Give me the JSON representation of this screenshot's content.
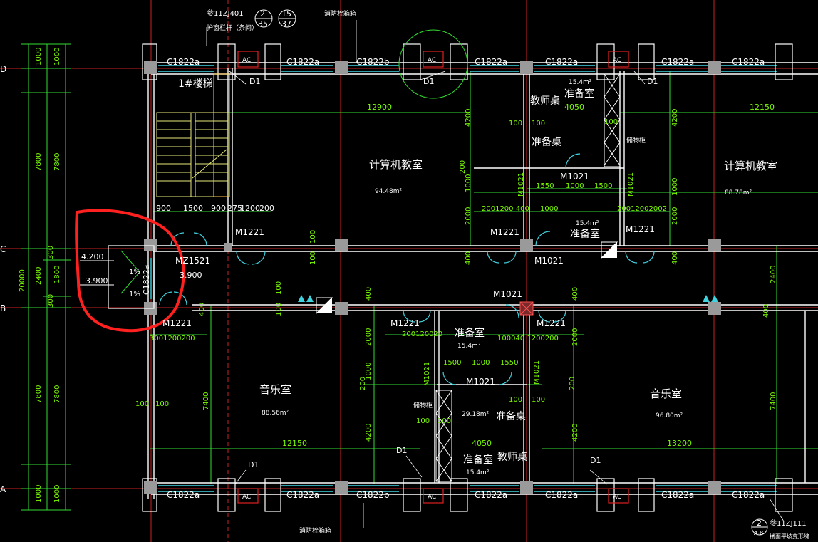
{
  "drawing": {
    "colors": {
      "background": "#000000",
      "axis": "#cc2222",
      "dim": "#33dd33",
      "wall": "#ffffff",
      "window": "#3fd3e0",
      "text": "#ffffff",
      "ac_box": "#e02020",
      "highlight": "#ff2020",
      "column": "#9a9a9a",
      "stair": "#e8e87a",
      "grid_line": "#00ff66"
    },
    "header": {
      "ref_code": "参11ZJ401",
      "circle_a": "2",
      "circle_a_sub": "35",
      "circle_b": "15",
      "circle_b_sub": "37",
      "rail_note": "护窗栏杆（条间）",
      "fire_box_top": "消防栓箱箱"
    },
    "axis_labels": {
      "d": "D",
      "c": "C",
      "b": "B",
      "a": "A"
    },
    "left_dims": {
      "top_1000a": "1000",
      "top_1000b": "1000",
      "dim_7800_top": "7800",
      "dim_7800_top_b": "7800",
      "dim_20000": "20000",
      "d300_top": "300",
      "d2400": "2400",
      "d1800": "1800",
      "d300_bot": "300",
      "dim_7800_bot": "7800",
      "dim_7800_bot_b": "7800",
      "bot_1000a": "1000",
      "bot_1000b": "1000"
    },
    "windows_top": [
      "C1822a",
      "C1822a",
      "C1822b",
      "C1822a",
      "C1822a",
      "C1822a",
      "C1822a"
    ],
    "windows_bottom": [
      "C1822a",
      "C1822a",
      "C1822b",
      "C1822a",
      "C1822a",
      "C1822a",
      "C1822a"
    ],
    "ac_label": "AC",
    "d1": "D1",
    "stair": {
      "label": "1#楼梯",
      "dims": [
        "900",
        "1500",
        "900",
        "275",
        "1200",
        "200"
      ]
    },
    "rooms": {
      "comp1": {
        "name": "计算机教室",
        "area": "94.48m²"
      },
      "comp2": {
        "name": "计算机教室",
        "area": "88.78m²"
      },
      "prep_top": {
        "name": "准备室",
        "area": "15.4m²"
      },
      "prep_mid": {
        "name": "准备室",
        "area": "15.4m²"
      },
      "music1": {
        "name": "音乐室",
        "area": "88.56m²"
      },
      "music2": {
        "name": "音乐室",
        "area": "96.80m²"
      },
      "prep_b1": {
        "name": "准备室",
        "area": "15.4m²"
      },
      "prep_b2": {
        "name": "准备室",
        "area": "29.18m²"
      },
      "prep_b3": {
        "name": "准备室",
        "area": "15.4m²"
      },
      "teacher_desk": "教师桌",
      "prep_desk": "准备桌",
      "cabinet": "储物柜"
    },
    "doors": {
      "m1221": "M1221",
      "m1021": "M1021",
      "mz1521": "MZ1521"
    },
    "dims": {
      "d12900": "12900",
      "d12150_top": "12150",
      "d12150_bot": "12150",
      "d13200": "13200",
      "d4050": "4050",
      "d4050b": "4050",
      "d4200": "4200",
      "d2000": "2000",
      "d1000": "1000",
      "d1550": "1550",
      "d1500": "1500",
      "d100": "100",
      "d400": "400",
      "d200": "200",
      "d7400": "7400",
      "d1200": "1200",
      "d300": "300",
      "d2001200400": "2001200 400",
      "d20012002002": "20012002002",
      "d3001200200": "3001200200",
      "d20012002003": "200120020",
      "d100400": "100040 1200200"
    },
    "highlight": {
      "elev_top": "4.200",
      "elev_bot": "3.900",
      "slope1": "1%",
      "slope2": "1%",
      "window": "C1822a",
      "elev_right": "3.900"
    },
    "footer": {
      "fire_box_bottom": "消防栓箱箱",
      "ref_code": "参11ZJ111",
      "circle": "2",
      "circle_sub": "A-8",
      "note": "楼面平坡变形缝"
    }
  }
}
